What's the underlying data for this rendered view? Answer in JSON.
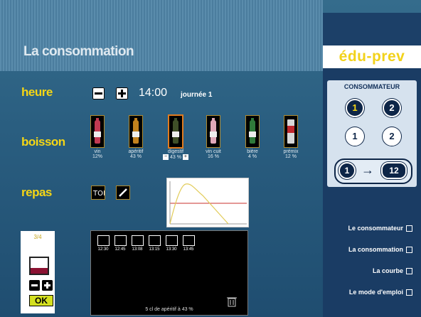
{
  "header": {
    "title": "La consommation",
    "brand": "édu-prev"
  },
  "heure": {
    "label": "heure",
    "time": "14:00",
    "day": "journée 1",
    "minus_icon": "minus-icon",
    "plus_icon": "plus-icon"
  },
  "boisson": {
    "label": "boisson",
    "drinks": [
      {
        "name": "vin",
        "pct": "12%",
        "color": "#c23a52"
      },
      {
        "name": "apéritif",
        "pct": "43 %",
        "color": "#c2821e"
      },
      {
        "name": "digestif",
        "pct": "43 %",
        "color": "#3f4f28",
        "selected": true
      },
      {
        "name": "vin cuit",
        "pct": "16 %",
        "color": "#e0a8b8"
      },
      {
        "name": "bière",
        "pct": "4 %",
        "color": "#2f7a3a"
      },
      {
        "name": "prémix",
        "pct": "12 %",
        "color": "#d8d8d8"
      }
    ]
  },
  "repas": {
    "label": "repas",
    "meal_icon": "cutlery-icon",
    "edit_icon": "pencil-icon"
  },
  "glass": {
    "fraction": "3/4",
    "level": 0.35,
    "ok_label": "OK"
  },
  "timeline": {
    "events": [
      {
        "time": "12:30",
        "icon": "glass-icon"
      },
      {
        "time": "12:45",
        "icon": "glass-icon"
      },
      {
        "time": "13:08",
        "icon": "cutlery-icon"
      },
      {
        "time": "13:15",
        "icon": "wineglass-icon"
      },
      {
        "time": "13:30",
        "icon": "wineglass-icon"
      },
      {
        "time": "13:45",
        "icon": "bottle-icon"
      }
    ],
    "caption": "5 cl de apéritif à 43 %",
    "trash_icon": "trash-icon"
  },
  "consommateur": {
    "title": "CONSOMMATEUR",
    "buttons": [
      "1",
      "2",
      "1",
      "2"
    ],
    "swap_from": "1",
    "swap_to": "12"
  },
  "menu": [
    "Le consommateur",
    "La consommation",
    "La courbe",
    "Le mode d'emploi"
  ],
  "colors": {
    "accent": "#f5d615",
    "panel": "#1a3c64",
    "background": "#2a5e80"
  }
}
